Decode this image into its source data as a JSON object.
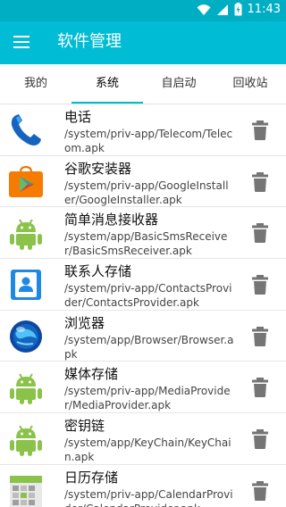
{
  "status": {
    "time": "11:43"
  },
  "header": {
    "title": "软件管理"
  },
  "tabs": [
    {
      "label": "我的"
    },
    {
      "label": "系统"
    },
    {
      "label": "自启动"
    },
    {
      "label": "回收站"
    }
  ],
  "active_tab": "系统",
  "colors": {
    "accent": "#00bcd4",
    "status_bar": "#00aec4"
  },
  "apps": [
    {
      "name": "电话",
      "path": "/system/priv-app/Telecom/Telecom.apk",
      "icon": "phone-icon"
    },
    {
      "name": "谷歌安装器",
      "path": "/system/priv-app/GoogleInstaller/GoogleInstaller.apk",
      "icon": "google-installer-icon"
    },
    {
      "name": "简单消息接收器",
      "path": "/system/app/BasicSmsReceiver/BasicSmsReceiver.apk",
      "icon": "android-icon"
    },
    {
      "name": "联系人存储",
      "path": "/system/priv-app/ContactsProvider/ContactsProvider.apk",
      "icon": "contacts-icon"
    },
    {
      "name": "浏览器",
      "path": "/system/app/Browser/Browser.apk",
      "icon": "browser-globe-icon"
    },
    {
      "name": "媒体存储",
      "path": "/system/priv-app/MediaProvider/MediaProvider.apk",
      "icon": "android-icon"
    },
    {
      "name": "密钥链",
      "path": "/system/app/KeyChain/KeyChain.apk",
      "icon": "android-icon"
    },
    {
      "name": "日历存储",
      "path": "/system/priv-app/CalendarProvider/CalendarProvider.apk",
      "icon": "calendar-icon"
    }
  ]
}
